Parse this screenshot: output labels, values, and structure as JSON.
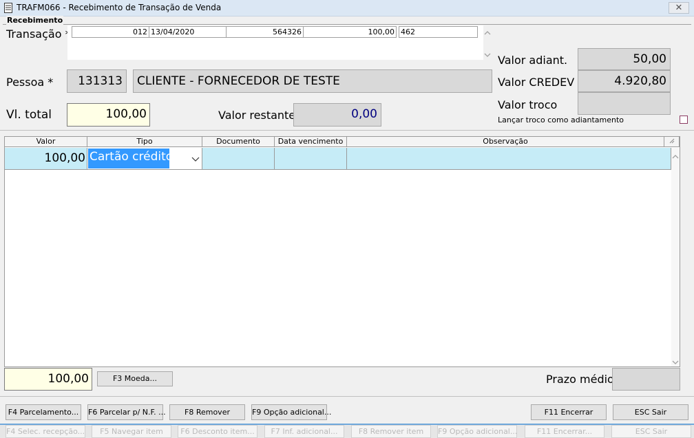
{
  "window": {
    "title": "TRAFM066 - Recebimento de Transação de Venda",
    "close_glyph": "✕"
  },
  "group": {
    "title": "Recebimento"
  },
  "transacao": {
    "label": "Transação *",
    "fields": [
      "012",
      "13/04/2020",
      "564326",
      "100,00",
      "462"
    ]
  },
  "pessoa": {
    "label": "Pessoa *",
    "code": "131313",
    "name": "CLIENTE - FORNECEDOR DE TESTE"
  },
  "vl_total": {
    "label": "Vl. total",
    "value": "100,00"
  },
  "valor_restante": {
    "label": "Valor restante",
    "value": "0,00"
  },
  "right_panel": {
    "valor_adiant_label": "Valor adiant.",
    "valor_adiant": "50,00",
    "valor_credev_label": "Valor CREDEV",
    "valor_credev": "4.920,80",
    "valor_troco_label": "Valor troco",
    "valor_troco": "",
    "lancar_troco_label": "Lançar troco como adiantamento"
  },
  "grid": {
    "headers": {
      "valor": "Valor",
      "tipo": "Tipo",
      "documento": "Documento",
      "data_vencimento": "Data vencimento",
      "observacao": "Observação"
    },
    "row": {
      "valor": "100,00",
      "tipo": "Cartão crédito",
      "documento": "",
      "data_vencimento": "",
      "observacao": ""
    }
  },
  "footer": {
    "total": "100,00",
    "moeda_button": "F3 Moeda...",
    "prazo_medio_label": "Prazo médio",
    "prazo_medio": ""
  },
  "buttons": {
    "parcelamento": "F4 Parcelamento...",
    "parcelar_nf": "F6 Parcelar p/ N.F. ...",
    "remover": "F8 Remover",
    "opcao_adicional": "F9 Opção adicional...",
    "encerrar": "F11 Encerrar",
    "sair": "ESC Sair"
  },
  "ghost_buttons": {
    "selec_recepcao": "F4 Selec. recepção...",
    "navegar_item": "F5 Navegar item",
    "desconto_item": "F6 Desconto item...",
    "inf_adicional": "F7 Inf. adicional...",
    "remover_item": "F8 Remover item",
    "opcao_adicional": "F9 Opção adicional...",
    "encerrar": "F11 Encerrar...",
    "sair": "ESC Sair"
  },
  "colors": {
    "accent": "#3399ff",
    "grid_row": "#c6ecf7",
    "value_blue": "#000080",
    "input_yellow": "#ffffe6"
  }
}
